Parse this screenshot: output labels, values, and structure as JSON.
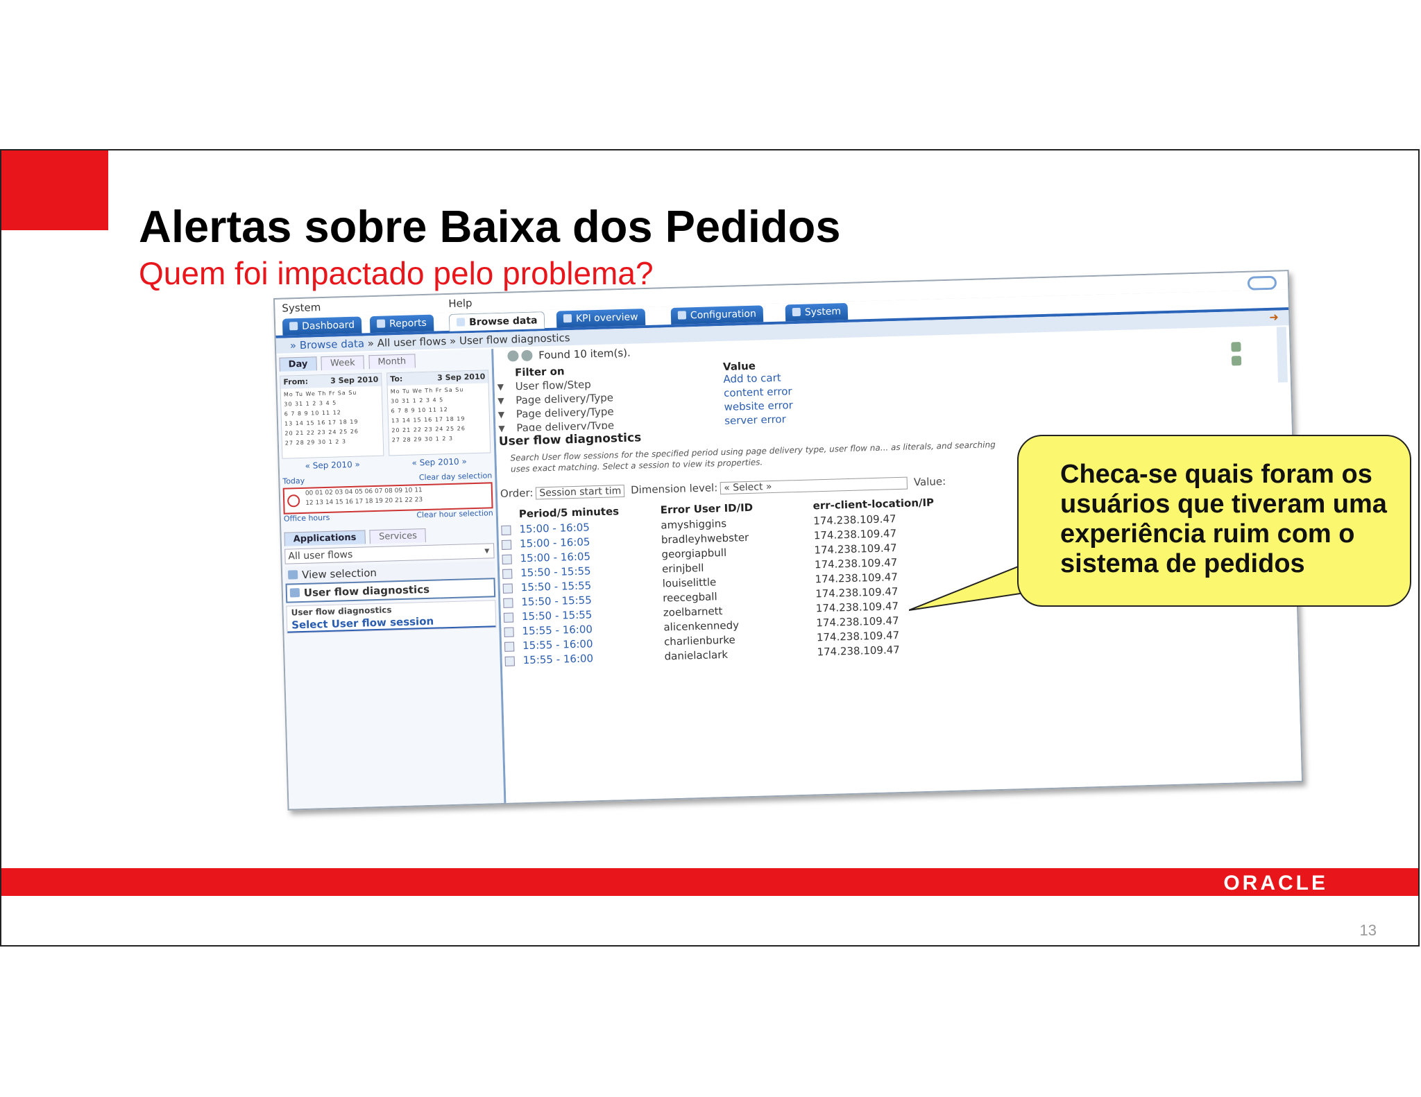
{
  "slide": {
    "title": "Alertas sobre Baixa dos Pedidos",
    "subtitle": "Quem foi impactado pelo problema?",
    "page_number": "13",
    "logo": "ORACLE",
    "accent_color": "#e8161b"
  },
  "callout": {
    "text": "Checa-se quais foram os usuários que tiveram uma experiência ruim com o sistema de pedidos"
  },
  "app": {
    "menu": [
      "System",
      "Help"
    ],
    "tabs": [
      {
        "label": "Dashboard",
        "icon": "dashboard-icon"
      },
      {
        "label": "Reports",
        "icon": "reports-icon"
      },
      {
        "label": "Browse data",
        "icon": "cube-icon"
      },
      {
        "label": "KPI overview",
        "icon": "gauge-icon"
      },
      {
        "label": "Configuration",
        "icon": "gear-icon"
      },
      {
        "label": "System",
        "icon": "computer-icon"
      }
    ],
    "breadcrumb": [
      "» Browse data",
      "» All user flows",
      "» User flow diagnostics"
    ],
    "left": {
      "period_tabs": [
        "Day",
        "Week",
        "Month"
      ],
      "from_label": "From:",
      "from_date": "3 Sep 2010",
      "to_label": "To:",
      "to_date": "3 Sep 2010",
      "month_nav_from": "« Sep 2010 »",
      "month_nav_to": "« Sep 2010 »",
      "today": "Today",
      "clear_day": "Clear day selection",
      "office_hours": "Office hours",
      "clear_hour": "Clear hour selection",
      "app_tabs": [
        "Applications",
        "Services"
      ],
      "flows_select": "All user flows",
      "view_selection": "View selection",
      "user_flow_diagnostics": "User flow diagnostics",
      "subpanel_title": "User flow diagnostics",
      "subpanel_link": "Select User flow session"
    },
    "right": {
      "found": "Found 10 item(s).",
      "filter_head": "Filter on",
      "value_head": "Value",
      "filters": [
        {
          "name": "User flow/Step",
          "value": "Add to cart"
        },
        {
          "name": "Page delivery/Type",
          "value": "content error"
        },
        {
          "name": "Page delivery/Type",
          "value": "website error"
        },
        {
          "name": "Page delivery/Type",
          "value": "server error"
        }
      ],
      "section_title": "User flow diagnostics",
      "description": "Search User flow sessions for the specified period using page delivery type, user flow na... as literals, and searching uses exact matching. Select a session to view its properties.",
      "order_label": "Order:",
      "order_value": "Session start tim",
      "dimension_label": "Dimension level:",
      "dimension_value": "« Select »",
      "value_label": "Value:",
      "columns": [
        "Period/5 minutes",
        "Error User ID/ID",
        "err-client-location/IP"
      ],
      "rows": [
        {
          "period": "15:00 - 16:05",
          "user": "amyshiggins",
          "ip": "174.238.109.47"
        },
        {
          "period": "15:00 - 16:05",
          "user": "bradleyhwebster",
          "ip": "174.238.109.47"
        },
        {
          "period": "15:00 - 16:05",
          "user": "georgiapbull",
          "ip": "174.238.109.47"
        },
        {
          "period": "15:50 - 15:55",
          "user": "erinjbell",
          "ip": "174.238.109.47"
        },
        {
          "period": "15:50 - 15:55",
          "user": "louiselittle",
          "ip": "174.238.109.47"
        },
        {
          "period": "15:50 - 15:55",
          "user": "reecegball",
          "ip": "174.238.109.47"
        },
        {
          "period": "15:50 - 15:55",
          "user": "zoelbarnett",
          "ip": "174.238.109.47"
        },
        {
          "period": "15:55 - 16:00",
          "user": "alicenkennedy",
          "ip": "174.238.109.47"
        },
        {
          "period": "15:55 - 16:00",
          "user": "charlienburke",
          "ip": "174.238.109.47"
        },
        {
          "period": "15:55 - 16:00",
          "user": "danielaclark",
          "ip": "174.238.109.47"
        }
      ]
    }
  }
}
